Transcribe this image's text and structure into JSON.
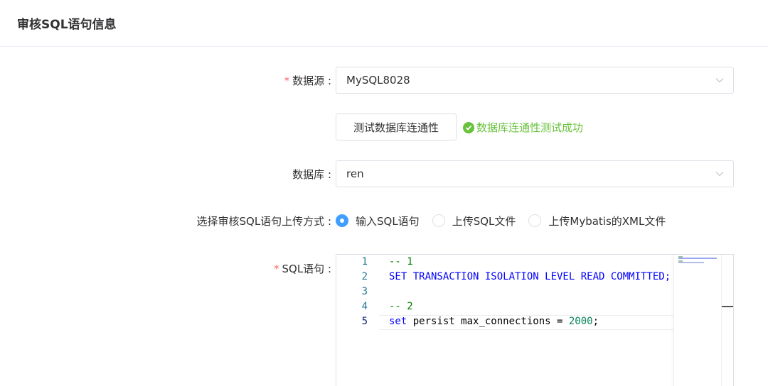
{
  "header": {
    "title": "审核SQL语句信息"
  },
  "form": {
    "datasource": {
      "label": "数据源 :",
      "required_mark": "*",
      "value": "MySQL8028"
    },
    "test_button": {
      "label": "测试数据库连通性"
    },
    "test_result": {
      "text": "数据库连通性测试成功",
      "color": "#67c23a"
    },
    "database": {
      "label": "数据库 :",
      "value": "ren"
    },
    "upload_method": {
      "label": "选择审核SQL语句上传方式 :",
      "options": [
        "输入SQL语句",
        "上传SQL文件",
        "上传Mybatis的XML文件"
      ],
      "selected": "输入SQL语句"
    },
    "sql": {
      "label": "SQL语句 :",
      "required_mark": "*",
      "line_numbers": [
        "1",
        "2",
        "3",
        "4",
        "5"
      ],
      "lines": {
        "l1": "-- 1",
        "l2": "SET TRANSACTION ISOLATION LEVEL READ COMMITTED;",
        "l4": "-- 2",
        "l5_kw": "set",
        "l5_mid": " persist max_connections ",
        "l5_op": "=",
        "l5_num": " 2000",
        "l5_end": ";"
      }
    }
  },
  "colors": {
    "accent": "#409eff",
    "required": "#f56c6c",
    "success": "#67c23a"
  },
  "icons": [
    "chevron-down-icon",
    "check-circle-icon"
  ]
}
